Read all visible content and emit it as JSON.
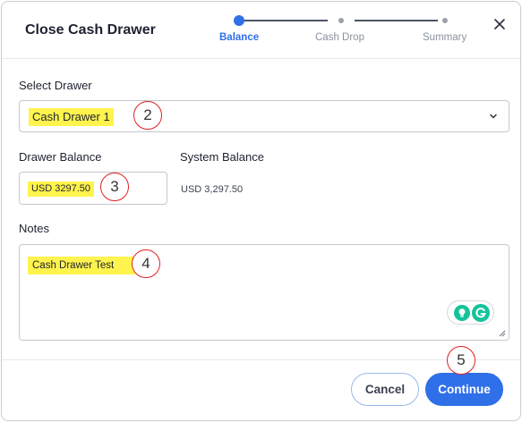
{
  "dialog": {
    "title": "Close Cash Drawer",
    "close_icon": "close-icon"
  },
  "stepper": {
    "steps": [
      {
        "label": "Balance",
        "state": "active"
      },
      {
        "label": "Cash Drop",
        "state": "pending"
      },
      {
        "label": "Summary",
        "state": "pending"
      }
    ]
  },
  "form": {
    "drawer": {
      "label": "Select Drawer",
      "value": "Cash Drawer 1",
      "icon": "chevron-down-icon"
    },
    "drawer_balance": {
      "label": "Drawer Balance",
      "value": "USD 3297.50"
    },
    "system_balance": {
      "label": "System Balance",
      "value": "USD 3,297.50"
    },
    "notes": {
      "label": "Notes",
      "value": "Cash Drawer Test"
    }
  },
  "grammarly": {
    "icons": [
      "lightbulb-icon",
      "grammarly-logo-icon"
    ]
  },
  "buttons": {
    "cancel": "Cancel",
    "continue": "Continue"
  },
  "callouts": [
    "2",
    "3",
    "4",
    "5"
  ],
  "colors": {
    "accent": "#2f6fe8",
    "highlight": "#fff34d",
    "callout_border": "#e02020",
    "grammarly_green": "#15c39a"
  }
}
